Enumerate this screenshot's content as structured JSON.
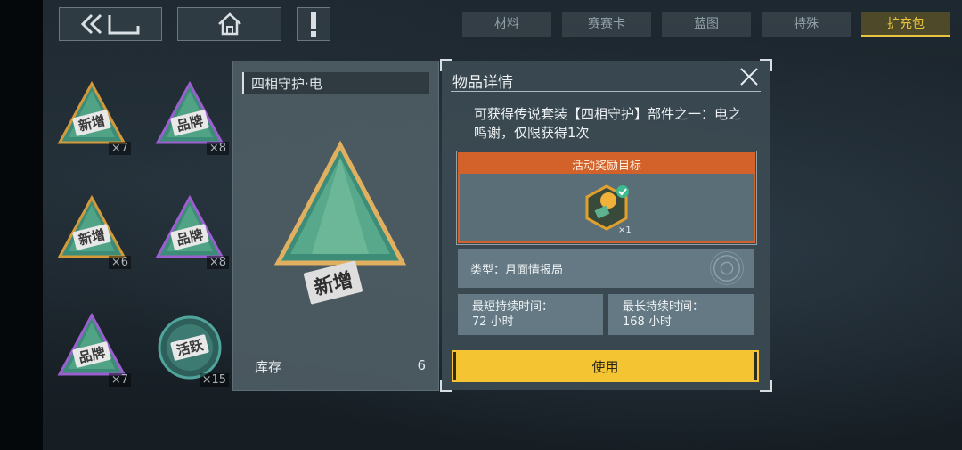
{
  "nav": {
    "back_icon": "back-arrow-icon",
    "home_icon": "home-icon",
    "alert_icon": "exclamation-icon"
  },
  "tabs": [
    {
      "label": "材料",
      "active": false
    },
    {
      "label": "赛赛卡",
      "active": false
    },
    {
      "label": "蓝图",
      "active": false
    },
    {
      "label": "特殊",
      "active": false
    },
    {
      "label": "扩充包",
      "active": true
    }
  ],
  "inventory": [
    {
      "label": "新增",
      "count": "×7",
      "frame": "#d49a3a"
    },
    {
      "label": "品牌",
      "count": "×8",
      "frame": "#9b5fd0"
    },
    {
      "label": "新增",
      "count": "×6",
      "frame": "#d49a3a"
    },
    {
      "label": "品牌",
      "count": "×8",
      "frame": "#9b5fd0"
    },
    {
      "label": "品牌",
      "count": "×7",
      "frame": "#9b5fd0"
    },
    {
      "label": "活跃",
      "count": "×15",
      "frame": "#4fa59b"
    }
  ],
  "detail": {
    "name": "四相守护·电",
    "gem_label": "新增",
    "stock_label": "库存",
    "stock_value": "6"
  },
  "item_panel": {
    "title": "物品详情",
    "description": "可获得传说套装【四相守护】部件之一：电之鸣谢，仅限获得1次",
    "reward_header": "活动奖励目标",
    "reward_count": "×1",
    "type_text": "类型：月面情报局",
    "min_duration_label": "最短持续时间：",
    "min_duration_value": "72 小时",
    "max_duration_label": "最长持续时间：",
    "max_duration_value": "168 小时",
    "use_button": "使用"
  },
  "colors": {
    "accent": "#f4c433",
    "reward_orange": "#d2612a",
    "tab_active": "#e8c440"
  }
}
